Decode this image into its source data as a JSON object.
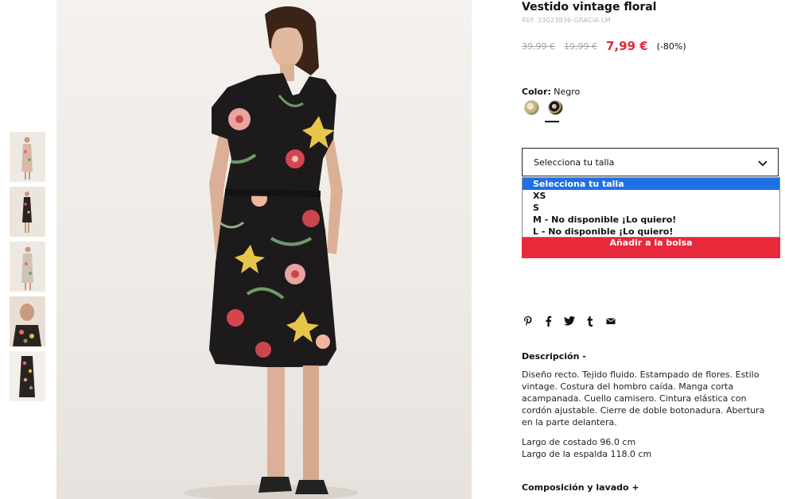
{
  "product": {
    "title": "Vestido vintage floral",
    "ref": "REF. 33023836-GRACIA-LM",
    "price_old_1": "39,99 €",
    "price_old_2": "19,99 €",
    "price_now": "7,99 €",
    "discount": "(-80%)"
  },
  "color": {
    "label": "Color:",
    "value": "Negro",
    "swatches": [
      "beige-floral",
      "negro-floral"
    ],
    "selected": 1
  },
  "size_select": {
    "current": "Selecciona tu talla",
    "options": [
      "Selecciona tu talla",
      "XS",
      "S",
      "M - No disponible ¡Lo quiero!",
      "L - No disponible ¡Lo quiero!"
    ]
  },
  "add_to_bag": "Añadir a la bolsa",
  "share_icons": [
    "pinterest-icon",
    "facebook-icon",
    "twitter-icon",
    "tumblr-icon",
    "mail-icon"
  ],
  "description": {
    "heading": "Descripción -",
    "text": "Diseño recto. Tejido fluido. Estampado de flores. Estilo vintage. Costura del hombro caída. Manga corta acampanada. Cuello camisero. Cintura elástica con cordón ajustable. Cierre de doble botonadura. Abertura en la parte delantera.",
    "length_front": "Largo de costado 96.0 cm",
    "length_back": "Largo de la espalda 118.0 cm"
  },
  "composition": {
    "heading": "Composición y lavado +"
  },
  "colors": {
    "accent": "#e8283b",
    "price": "#e2273b",
    "select_highlight": "#1e6fe8"
  }
}
